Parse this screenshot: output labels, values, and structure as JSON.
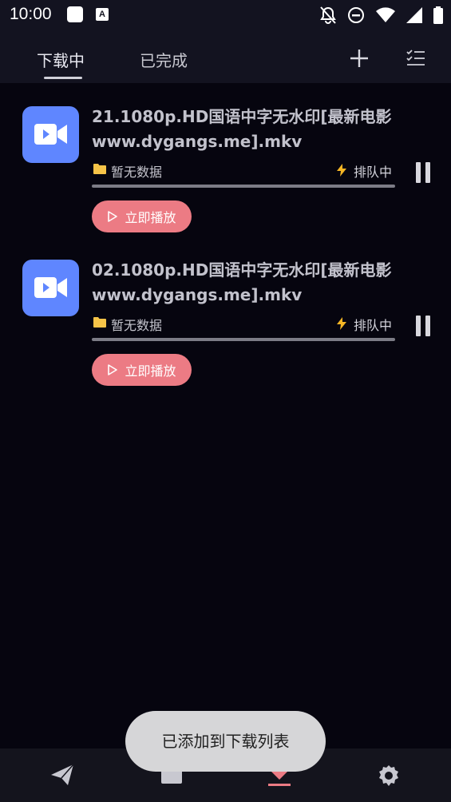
{
  "status_bar": {
    "time": "10:00",
    "badge_letter": "A"
  },
  "top_bar": {
    "tabs": [
      {
        "label": "下载中",
        "active": true
      },
      {
        "label": "已完成",
        "active": false
      }
    ],
    "add_icon": "plus-icon",
    "list_icon": "checklist-icon"
  },
  "downloads": [
    {
      "name": "21.1080p.HD国语中字无水印[最新电影www.dygangs.me].mkv",
      "folder_label": "暂无数据",
      "status": "排队中",
      "progress": 0,
      "play_label": "立即播放"
    },
    {
      "name": "02.1080p.HD国语中字无水印[最新电影www.dygangs.me].mkv",
      "folder_label": "暂无数据",
      "status": "排队中",
      "progress": 0,
      "play_label": "立即播放"
    }
  ],
  "toast": {
    "message": "已添加到下载列表"
  },
  "bottom_nav": {
    "items": [
      {
        "icon": "send-icon",
        "active": false
      },
      {
        "icon": "folder-icon",
        "active": false
      },
      {
        "icon": "download-icon",
        "active": true
      },
      {
        "icon": "settings-icon",
        "active": false
      }
    ]
  },
  "colors": {
    "background": "#06050f",
    "accent": "#ec7b84",
    "thumb": "#5f86ff",
    "bar": "#131320"
  }
}
